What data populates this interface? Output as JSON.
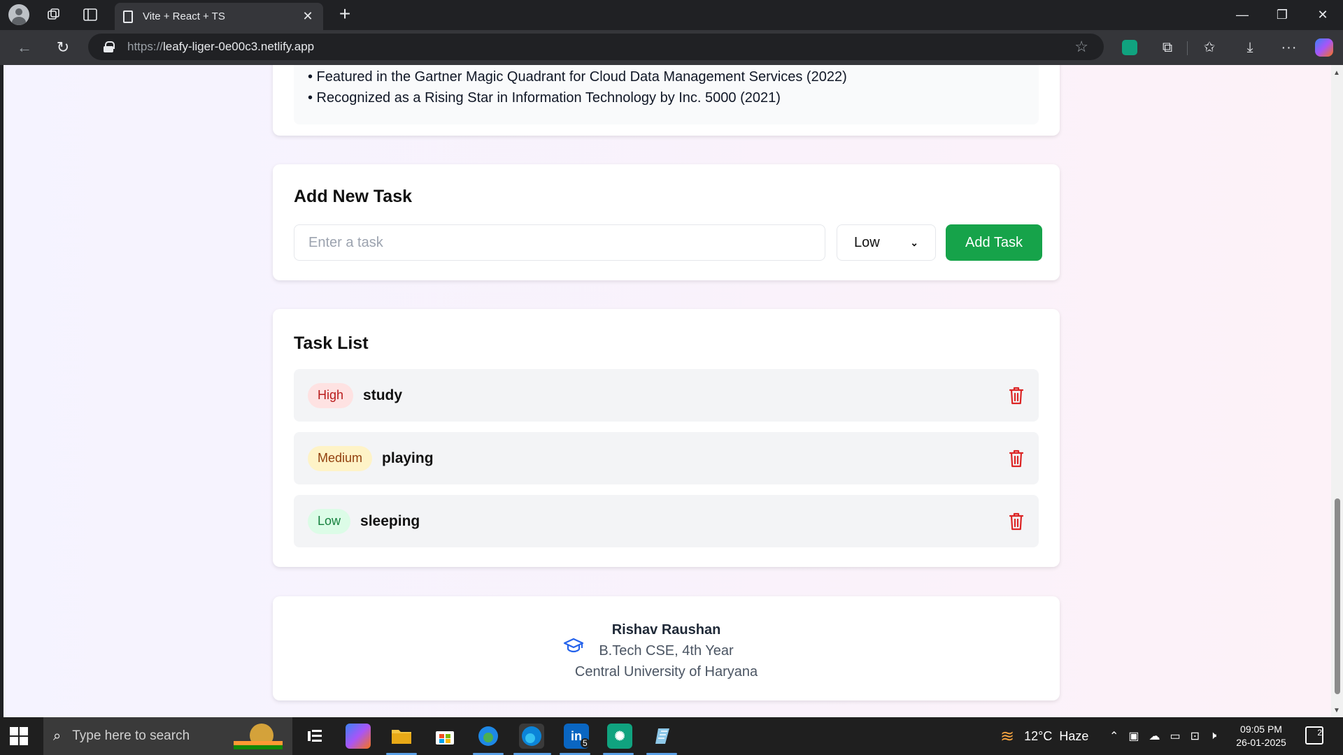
{
  "browser": {
    "tab_title": "Vite + React + TS",
    "url_host": "leafy-liger-0e00c3.netlify.app",
    "url_prefix": "https://"
  },
  "awards": {
    "items": [
      "• Featured in the Gartner Magic Quadrant for Cloud Data Management Services (2022)",
      "• Recognized as a Rising Star in Information Technology by Inc. 5000 (2021)"
    ]
  },
  "add_task": {
    "title": "Add New Task",
    "input_placeholder": "Enter a task",
    "input_value": "",
    "priority_selected": "Low",
    "button_label": "Add Task"
  },
  "task_list": {
    "title": "Task List",
    "tasks": [
      {
        "priority": "High",
        "text": "study"
      },
      {
        "priority": "Medium",
        "text": "playing"
      },
      {
        "priority": "Low",
        "text": "sleeping"
      }
    ]
  },
  "footer": {
    "name": "Rishav Raushan",
    "program": "B.Tech CSE, 4th Year",
    "university": "Central University of Haryana"
  },
  "taskbar": {
    "search_placeholder": "Type here to search",
    "linkedin_badge": "5",
    "weather_temp": "12°C",
    "weather_desc": "Haze",
    "time": "09:05 PM",
    "date": "26-01-2025",
    "notification_count": "2"
  },
  "colors": {
    "accent_green": "#16a34a",
    "delete_red": "#dc2626",
    "icon_blue": "#2563eb"
  }
}
